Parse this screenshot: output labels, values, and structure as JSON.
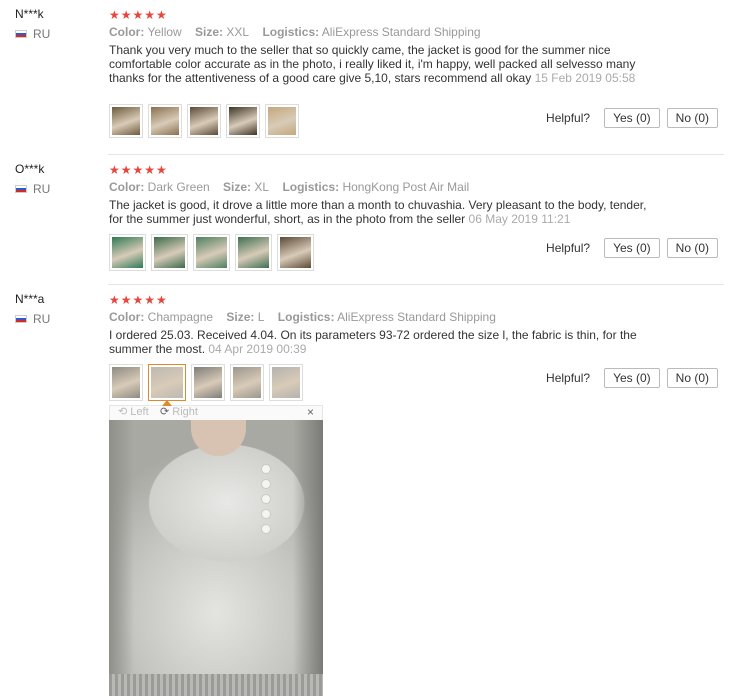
{
  "reviews": [
    {
      "user": "N***k",
      "country": "RU",
      "stars": "★★★★★",
      "color_label": "Color:",
      "color": "Yellow",
      "size_label": "Size:",
      "size": "XXL",
      "logistics_label": "Logistics:",
      "logistics": "AliExpress Standard Shipping",
      "text": "Thank you very much to the seller that so quickly came, the jacket is good for the summer nice comfortable color accurate as in the photo, i really liked it, i'm happy, well packed all selvesso many thanks for the attentiveness of a good care give 5,10, stars recommend all okay",
      "date": "15 Feb 2019 05:58",
      "helpful_label": "Helpful?",
      "yes_label": "Yes (0)",
      "no_label": "No (0)",
      "thumb_colors": [
        "#6d5a3c",
        "#8a7050",
        "#5c4a38",
        "#3e3528",
        "#c4a77d"
      ]
    },
    {
      "user": "O***k",
      "country": "RU",
      "stars": "★★★★★",
      "color_label": "Color:",
      "color": "Dark Green",
      "size_label": "Size:",
      "size": "XL",
      "logistics_label": "Logistics:",
      "logistics": "HongKong Post Air Mail",
      "text": "The jacket is good, it drove a little more than a month to chuvashia. Very pleasant to the body, tender, for the summer just wonderful, short, as in the photo from the seller",
      "date": "06 May 2019 11:21",
      "helpful_label": "Helpful?",
      "yes_label": "Yes (0)",
      "no_label": "No (0)",
      "thumb_colors": [
        "#2f7a55",
        "#3c6b4c",
        "#4e8060",
        "#3f6f52",
        "#5a4a36"
      ]
    },
    {
      "user": "N***a",
      "country": "RU",
      "stars": "★★★★★",
      "color_label": "Color:",
      "color": "Champagne",
      "size_label": "Size:",
      "size": "L",
      "logistics_label": "Logistics:",
      "logistics": "AliExpress Standard Shipping",
      "text": "I ordered 25.03. Received 4.04. On its parameters 93-72 ordered the size l, the fabric is thin, for the summer the most.",
      "date": "04 Apr 2019 00:39",
      "helpful_label": "Helpful?",
      "yes_label": "Yes (0)",
      "no_label": "No (0)",
      "thumb_colors": [
        "#8e8a82",
        "#bdb9b2",
        "#7f7d78",
        "#9c968c",
        "#b5b2ad"
      ]
    }
  ],
  "viewer": {
    "left_label": "Left",
    "right_label": "Right",
    "close_label": "×"
  }
}
